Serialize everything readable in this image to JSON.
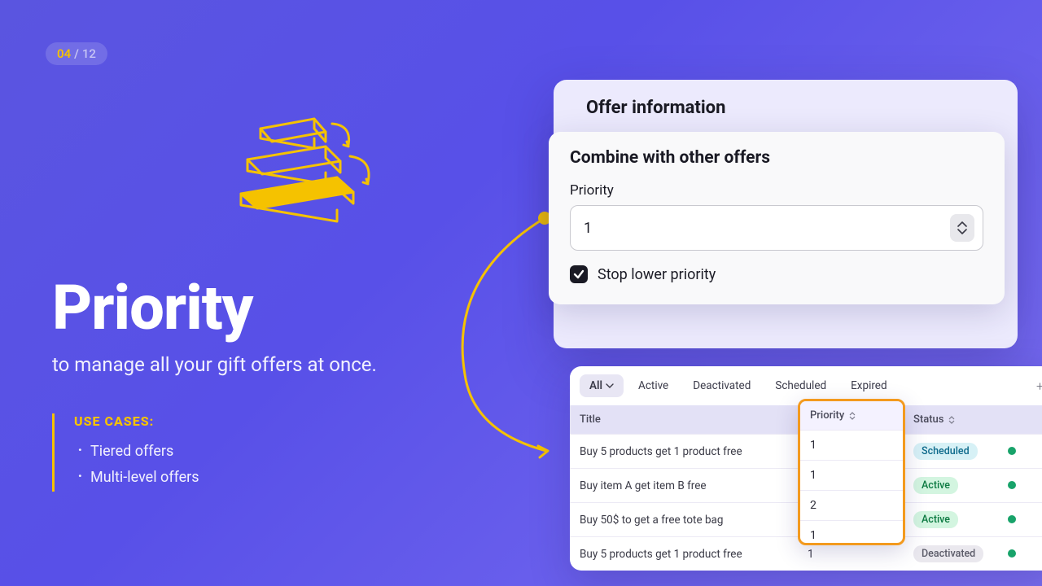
{
  "pager": {
    "current": "04",
    "separator": "/",
    "total": "12"
  },
  "headline": "Priority",
  "subhead": "to manage all your gift offers at once.",
  "use_cases_title": "USE CASES:",
  "use_cases": [
    "Tiered offers",
    "Multi-level offers"
  ],
  "offer": {
    "panel_title": "Offer information",
    "combine_title": "Combine with other offers",
    "priority_label": "Priority",
    "priority_value": "1",
    "stop_lower_label": "Stop lower priority",
    "stop_lower_checked": true
  },
  "tabs": {
    "items": [
      "All",
      "Active",
      "Deactivated",
      "Scheduled",
      "Expired"
    ],
    "active_index": 0
  },
  "table": {
    "columns": {
      "title": "Title",
      "priority": "Priority",
      "status": "Status"
    },
    "rows": [
      {
        "title": "Buy 5 products get 1 product free",
        "priority": "1",
        "status": "Scheduled",
        "status_class": "b-sched"
      },
      {
        "title": "Buy item A get item B free",
        "priority": "1",
        "status": "Active",
        "status_class": "b-active"
      },
      {
        "title": "Buy 50$ to get a free tote bag",
        "priority": "2",
        "status": "Active",
        "status_class": "b-active"
      },
      {
        "title": "Buy 5 products get 1 product free",
        "priority": "1",
        "status": "Deactivated",
        "status_class": "b-deact"
      }
    ]
  },
  "colors": {
    "accent": "#f5c200",
    "highlight_border": "#f39a1e"
  }
}
